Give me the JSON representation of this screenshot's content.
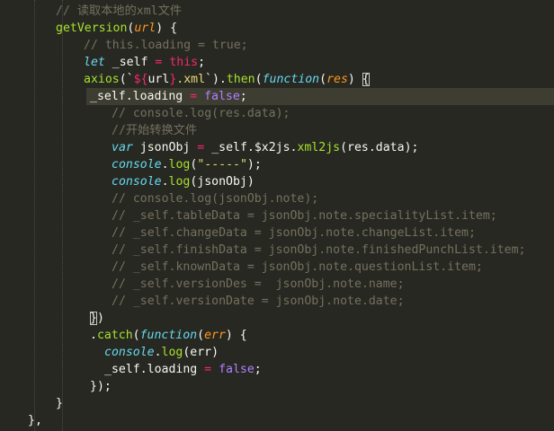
{
  "lines": [
    {
      "indent": 62,
      "tokens": [
        {
          "text": "// 读取本地的xml文件",
          "c": "cmt"
        }
      ]
    },
    {
      "indent": 62,
      "tokens": [
        {
          "text": "getVersion",
          "c": "fn"
        },
        {
          "text": "(",
          "c": "pl"
        },
        {
          "text": "url",
          "c": "prm"
        },
        {
          "text": ") {",
          "c": "pl"
        }
      ]
    },
    {
      "indent": 93,
      "tokens": [
        {
          "text": "// this.loading = true;",
          "c": "cmt"
        }
      ]
    },
    {
      "indent": 93,
      "tokens": [
        {
          "text": "let",
          "c": "st"
        },
        {
          "text": " _self ",
          "c": "pl"
        },
        {
          "text": "=",
          "c": "kw"
        },
        {
          "text": " ",
          "c": "pl"
        },
        {
          "text": "this",
          "c": "kw"
        },
        {
          "text": ";",
          "c": "pl"
        }
      ]
    },
    {
      "indent": 93,
      "tokens": [
        {
          "text": "axios",
          "c": "fn"
        },
        {
          "text": "(`",
          "c": "pl"
        },
        {
          "text": "${",
          "c": "kw"
        },
        {
          "text": "url",
          "c": "pl"
        },
        {
          "text": "}",
          "c": "kw"
        },
        {
          "text": ".xml",
          "c": "str"
        },
        {
          "text": "`).",
          "c": "pl"
        },
        {
          "text": "then",
          "c": "fn"
        },
        {
          "text": "(",
          "c": "pl"
        },
        {
          "text": "function",
          "c": "st"
        },
        {
          "text": "(",
          "c": "pl"
        },
        {
          "text": "res",
          "c": "prm"
        },
        {
          "text": ") ",
          "c": "pl"
        },
        {
          "text": "{",
          "c": "pl",
          "box": true
        }
      ]
    },
    {
      "indent": 100,
      "active": true,
      "tokens": [
        {
          "text": "_self.loading ",
          "c": "pl"
        },
        {
          "text": "=",
          "c": "kw"
        },
        {
          "text": " ",
          "c": "pl"
        },
        {
          "text": "false",
          "c": "bl"
        },
        {
          "text": ";",
          "c": "pl"
        }
      ]
    },
    {
      "indent": 124,
      "tokens": [
        {
          "text": "// console.log(res.data);",
          "c": "cmt"
        }
      ]
    },
    {
      "indent": 124,
      "tokens": [
        {
          "text": "//开始转换文件",
          "c": "cmt"
        }
      ]
    },
    {
      "indent": 124,
      "tokens": [
        {
          "text": "var",
          "c": "st"
        },
        {
          "text": " jsonObj ",
          "c": "pl"
        },
        {
          "text": "=",
          "c": "kw"
        },
        {
          "text": " _self.$x2js.",
          "c": "pl"
        },
        {
          "text": "xml2js",
          "c": "fn"
        },
        {
          "text": "(res.data);",
          "c": "pl"
        }
      ]
    },
    {
      "indent": 124,
      "tokens": [
        {
          "text": "console",
          "c": "st"
        },
        {
          "text": ".",
          "c": "pl"
        },
        {
          "text": "log",
          "c": "fn"
        },
        {
          "text": "(",
          "c": "pl"
        },
        {
          "text": "\"-----\"",
          "c": "str"
        },
        {
          "text": ");",
          "c": "pl"
        }
      ]
    },
    {
      "indent": 124,
      "tokens": [
        {
          "text": "console",
          "c": "st"
        },
        {
          "text": ".",
          "c": "pl"
        },
        {
          "text": "log",
          "c": "fn"
        },
        {
          "text": "(jsonObj)",
          "c": "pl"
        }
      ]
    },
    {
      "indent": 124,
      "tokens": [
        {
          "text": "// console.log(jsonObj.note);",
          "c": "cmt"
        }
      ]
    },
    {
      "indent": 124,
      "tokens": [
        {
          "text": "// _self.tableData = jsonObj.note.specialityList.item;",
          "c": "cmt"
        }
      ]
    },
    {
      "indent": 124,
      "tokens": [
        {
          "text": "// _self.changeData = jsonObj.note.changeList.item;",
          "c": "cmt"
        }
      ]
    },
    {
      "indent": 124,
      "tokens": [
        {
          "text": "// _self.finishData = jsonObj.note.finishedPunchList.item;",
          "c": "cmt"
        }
      ]
    },
    {
      "indent": 124,
      "tokens": [
        {
          "text": "// _self.knownData = jsonObj.note.questionList.item;",
          "c": "cmt"
        }
      ]
    },
    {
      "indent": 124,
      "tokens": [
        {
          "text": "// _self.versionDes =  jsonObj.note.name;",
          "c": "cmt"
        }
      ]
    },
    {
      "indent": 124,
      "tokens": [
        {
          "text": "// _self.versionDate = jsonObj.note.date;",
          "c": "cmt"
        }
      ]
    },
    {
      "indent": 100,
      "tokens": [
        {
          "text": "}",
          "c": "pl",
          "box": true
        },
        {
          "text": ")",
          "c": "pl"
        }
      ]
    },
    {
      "indent": 100,
      "tokens": [
        {
          "text": ".",
          "c": "pl"
        },
        {
          "text": "catch",
          "c": "fn"
        },
        {
          "text": "(",
          "c": "pl"
        },
        {
          "text": "function",
          "c": "st"
        },
        {
          "text": "(",
          "c": "pl"
        },
        {
          "text": "err",
          "c": "prm"
        },
        {
          "text": ") {",
          "c": "pl"
        }
      ]
    },
    {
      "indent": 116,
      "tokens": [
        {
          "text": "console",
          "c": "st"
        },
        {
          "text": ".",
          "c": "pl"
        },
        {
          "text": "log",
          "c": "fn"
        },
        {
          "text": "(err)",
          "c": "pl"
        }
      ]
    },
    {
      "indent": 116,
      "tokens": [
        {
          "text": "_self.loading ",
          "c": "pl"
        },
        {
          "text": "=",
          "c": "kw"
        },
        {
          "text": " ",
          "c": "pl"
        },
        {
          "text": "false",
          "c": "bl"
        },
        {
          "text": ";",
          "c": "pl"
        }
      ]
    },
    {
      "indent": 100,
      "tokens": [
        {
          "text": "});",
          "c": "pl"
        }
      ]
    },
    {
      "indent": 62,
      "tokens": [
        {
          "text": "}",
          "c": "pl"
        }
      ]
    },
    {
      "indent": 31,
      "tokens": [
        {
          "text": "},",
          "c": "pl"
        }
      ]
    }
  ]
}
